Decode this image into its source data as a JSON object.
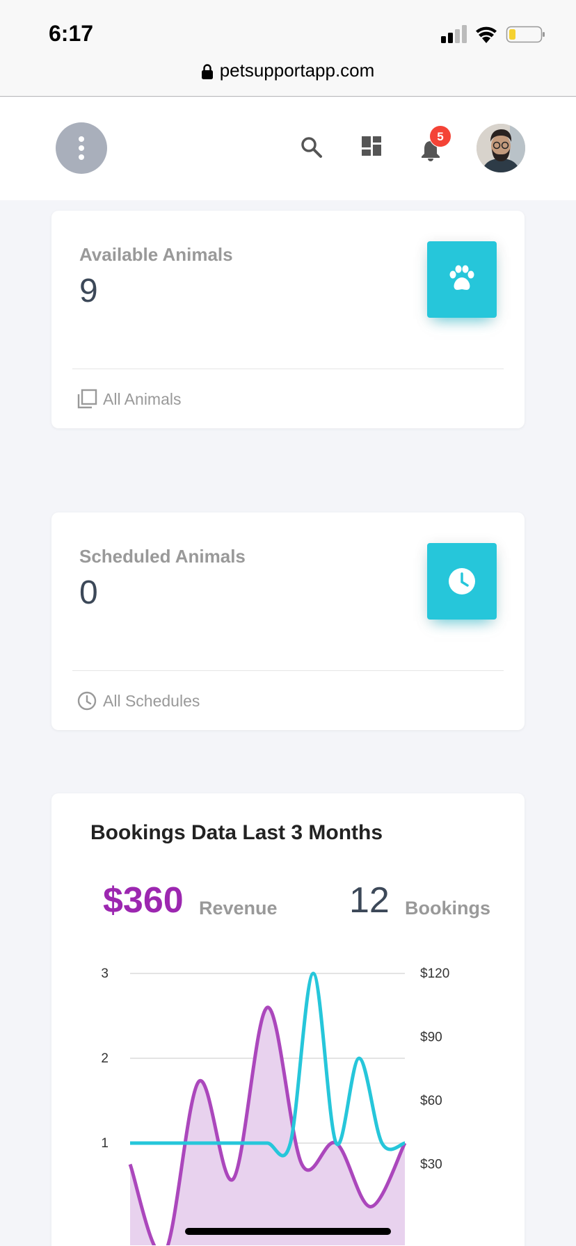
{
  "status_bar": {
    "time": "6:17",
    "url": "petsupportapp.com"
  },
  "header": {
    "notification_count": "5"
  },
  "cards": {
    "available": {
      "title": "Available Animals",
      "value": "9",
      "footer": "All Animals"
    },
    "scheduled": {
      "title": "Scheduled Animals",
      "value": "0",
      "footer": "All Schedules"
    }
  },
  "bookings": {
    "title": "Bookings Data Last 3 Months",
    "revenue_value": "$360",
    "revenue_label": "Revenue",
    "bookings_value": "12",
    "bookings_label": "Bookings"
  },
  "colors": {
    "accent_cyan": "#26c6da",
    "purple": "#9c27b0",
    "badge_red": "#f44336"
  },
  "icons": [
    "search-icon",
    "dashboard-icon",
    "bell-icon",
    "paw-icon",
    "clock-icon",
    "copy-icon",
    "lock-icon"
  ],
  "chart_data": {
    "type": "line",
    "title": "",
    "y_left_ticks": [
      "1",
      "2",
      "3"
    ],
    "y_right_ticks": [
      "$30",
      "$60",
      "$90",
      "$120"
    ],
    "ylim_left": [
      0,
      3
    ],
    "ylim_right": [
      0,
      120
    ],
    "grid": true,
    "series": [
      {
        "axis": "left",
        "color": "#26c6da",
        "values": [
          1,
          1,
          1,
          1,
          1,
          1,
          1,
          1,
          3,
          1,
          2,
          1,
          1
        ]
      },
      {
        "axis": "right",
        "color": "#ab47bc",
        "fill": "#e8d2ee",
        "values": [
          30,
          -12,
          69,
          23,
          104,
          30,
          40,
          10,
          40
        ]
      }
    ]
  }
}
